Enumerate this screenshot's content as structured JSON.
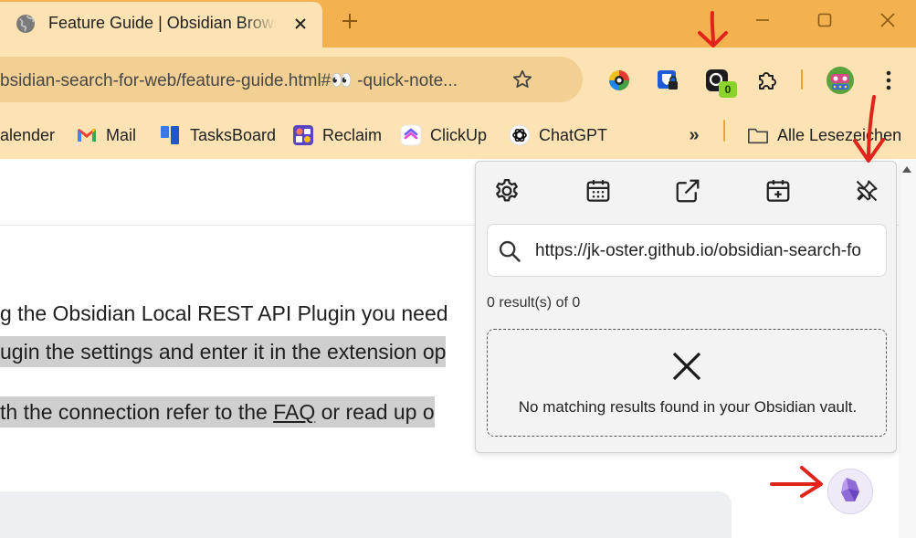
{
  "browser": {
    "tab": {
      "title": "Feature Guide | Obsidian Browser Search"
    },
    "address_bar": {
      "url": "bsidian-search-for-web/feature-guide.html#👀 -quick-note..."
    },
    "extension_badge": "0"
  },
  "bookmarks": [
    {
      "label": "alender",
      "icon": "calendar-icon"
    },
    {
      "label": "Mail",
      "icon": "gmail-icon"
    },
    {
      "label": "TasksBoard",
      "icon": "tasksboard-icon"
    },
    {
      "label": "Reclaim",
      "icon": "reclaim-icon"
    },
    {
      "label": "ClickUp",
      "icon": "clickup-icon"
    },
    {
      "label": "ChatGPT",
      "icon": "chatgpt-icon"
    }
  ],
  "bookmarks_folder": "Alle Lesezeichen",
  "page": {
    "line1": "g the Obsidian Local REST API Plugin you need",
    "line2": "ugin the settings and enter it in the extension op",
    "line3_before": "th the connection refer to the ",
    "line3_link": "FAQ",
    "line3_after": " or read up o"
  },
  "popup": {
    "search_value": "https://jk-oster.github.io/obsidian-search-for-web/feature-guide.html",
    "result_count": "0 result(s) of 0",
    "no_results_text": "No matching results found in your Obsidian vault."
  },
  "colors": {
    "tabstrip": "#f3b24f",
    "toolbar": "#fde3b4",
    "annotation_red": "#e0231b",
    "obsidian_purple": "#8e6bd6"
  }
}
